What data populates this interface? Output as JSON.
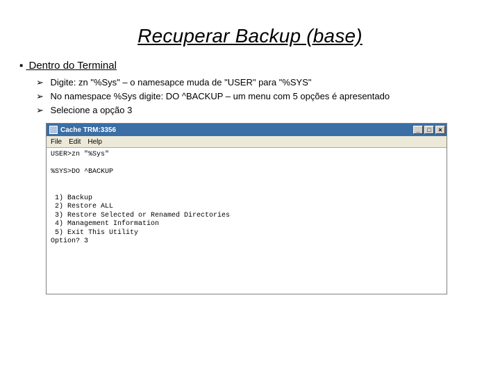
{
  "slide": {
    "title": "Recuperar Backup (base)",
    "sub_bullet_glyph": "▪",
    "sub_heading": "Dentro do Terminal",
    "tri_glyph": "➢",
    "bullets": {
      "b1": "Digite: zn \"%Sys\" – o namesapce muda de \"USER\" para \"%SYS\"",
      "b2": "No namespace %Sys digite: DO ^BACKUP – um menu com 5 opções é apresentado",
      "b3": "Selecione a opção 3"
    }
  },
  "terminal": {
    "window_title": "Cache TRM:3356",
    "btn_min": "_",
    "btn_max": "□",
    "btn_close": "×",
    "menu": {
      "file": "File",
      "edit": "Edit",
      "help": "Help"
    },
    "lines": {
      "l1": "USER>zn \"%Sys\"",
      "l2": "",
      "l3": "%SYS>DO ^BACKUP",
      "l4": "",
      "l5": "",
      "l6": " 1) Backup",
      "l7": " 2) Restore ALL",
      "l8": " 3) Restore Selected or Renamed Directories",
      "l9": " 4) Management Information",
      "l10": " 5) Exit This Utility",
      "l11": "Option? 3"
    }
  }
}
